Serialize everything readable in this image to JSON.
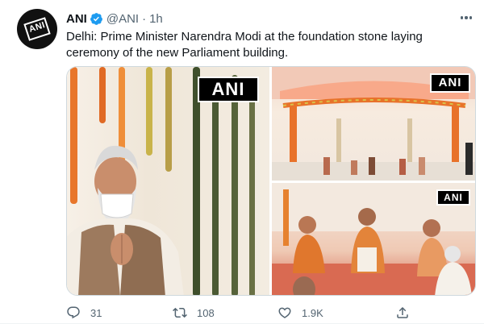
{
  "author": {
    "name": "ANI",
    "handle": "@ANI",
    "separator": "·",
    "time": "1h",
    "avatar_text": "ANI"
  },
  "tweet": {
    "text": "Delhi: Prime Minister Narendra Modi at the foundation stone laying ceremony of the new Parliament building."
  },
  "media": {
    "watermark": "ANI",
    "photos": [
      "photo-main",
      "photo-top-right",
      "photo-bottom-right"
    ]
  },
  "actions": {
    "replies": "31",
    "retweets": "108",
    "likes": "1.9K"
  },
  "icons": {
    "verified": "verified-badge-icon",
    "more": "more-options-icon",
    "reply": "reply-icon",
    "retweet": "retweet-icon",
    "like": "like-icon",
    "share": "share-icon"
  },
  "colors": {
    "verified_blue": "#1d9bf0",
    "muted_text": "#536471",
    "primary_text": "#0f1419"
  }
}
